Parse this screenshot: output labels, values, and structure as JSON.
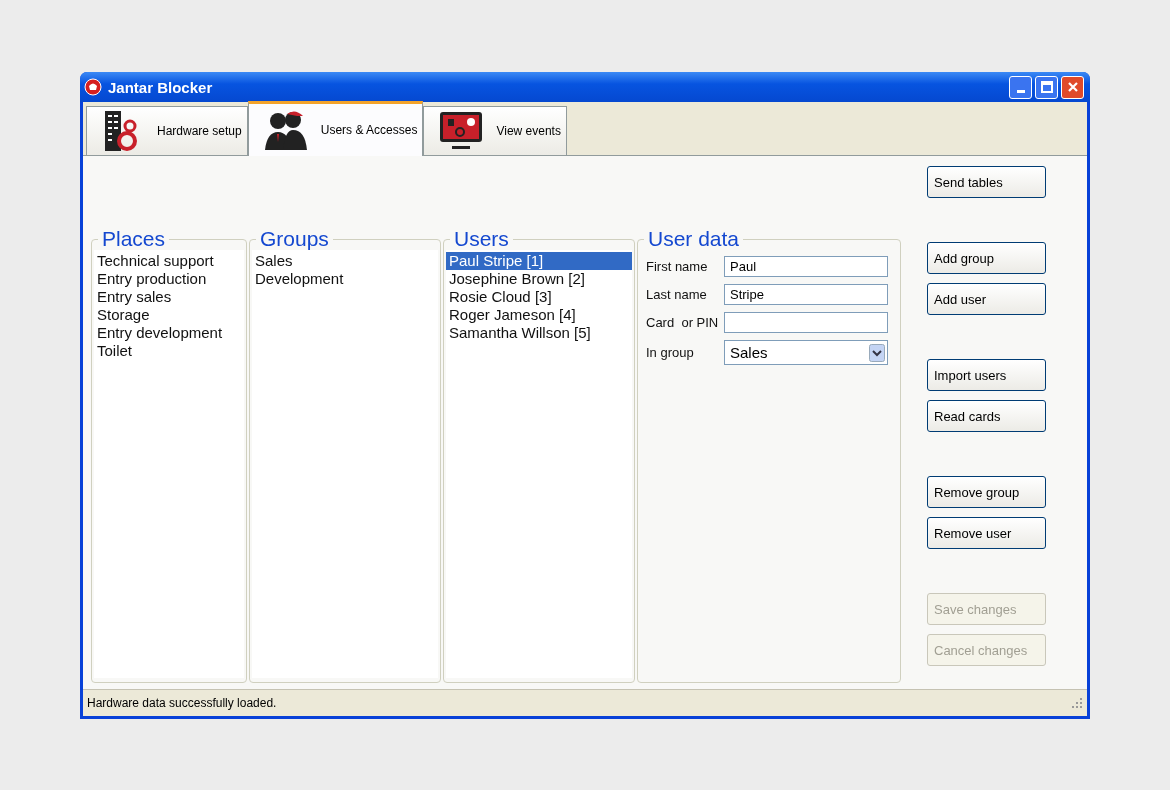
{
  "window": {
    "title": "Jantar Blocker"
  },
  "tabs": [
    {
      "label": "Hardware setup",
      "kind": "building",
      "selected": false
    },
    {
      "label": "Users & Accesses",
      "kind": "people",
      "selected": true
    },
    {
      "label": "View events",
      "kind": "monitor",
      "selected": false
    }
  ],
  "panels": [
    {
      "title": "Places",
      "items": [
        {
          "label": "Technical support",
          "selected": false
        },
        {
          "label": "Entry production",
          "selected": false
        },
        {
          "label": "Entry sales",
          "selected": false
        },
        {
          "label": "Storage",
          "selected": false
        },
        {
          "label": "Entry development",
          "selected": false
        },
        {
          "label": "Toilet",
          "selected": false
        }
      ]
    },
    {
      "title": "Groups",
      "items": [
        {
          "label": "Sales",
          "selected": false
        },
        {
          "label": "Development",
          "selected": false
        }
      ]
    },
    {
      "title": "Users",
      "items": [
        {
          "label": "Paul Stripe [1]",
          "selected": true
        },
        {
          "label": "Josephine Brown [2]",
          "selected": false
        },
        {
          "label": "Rosie Cloud [3]",
          "selected": false
        },
        {
          "label": "Roger Jameson [4]",
          "selected": false
        },
        {
          "label": "Samantha Willson [5]",
          "selected": false
        }
      ]
    }
  ],
  "user_data": {
    "title": "User data",
    "fields": [
      {
        "kind": "text",
        "label": "First name",
        "value": "Paul"
      },
      {
        "kind": "text",
        "label": "Last name",
        "value": "Stripe"
      },
      {
        "kind": "text",
        "label": "Card  or PIN"
      },
      {
        "kind": "select",
        "label": "In group",
        "value": "Sales"
      }
    ]
  },
  "button_groups": [
    [
      {
        "label": "Send tables",
        "disabled": false
      }
    ],
    [
      {
        "label": "Add group",
        "disabled": false
      },
      {
        "label": "Add user",
        "disabled": false
      }
    ],
    [
      {
        "label": "Import users",
        "disabled": false
      },
      {
        "label": "Read cards",
        "disabled": false
      }
    ],
    [
      {
        "label": "Remove group",
        "disabled": false
      },
      {
        "label": "Remove user",
        "disabled": false
      }
    ],
    [
      {
        "label": "Save changes",
        "disabled": true
      },
      {
        "label": "Cancel changes",
        "disabled": true
      }
    ]
  ],
  "status_bar": {
    "text": "Hardware data successfully loaded."
  }
}
